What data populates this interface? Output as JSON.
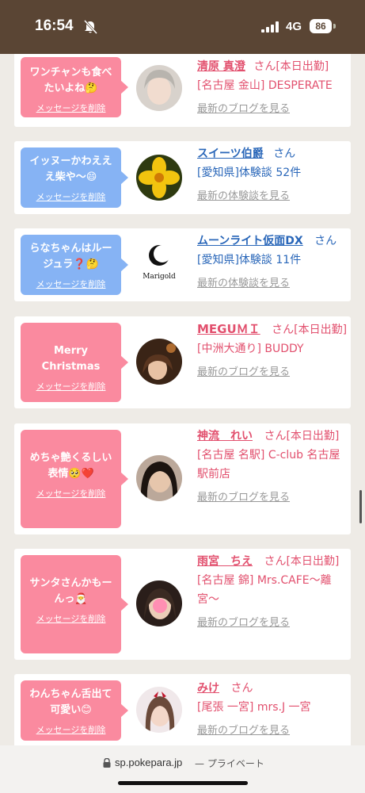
{
  "status_bar": {
    "time": "16:54",
    "network": "4G",
    "battery": "86"
  },
  "colors": {
    "status_bg": "#5a4534",
    "pink_bubble": "#fa8a9f",
    "blue_bubble": "#86b3f4",
    "name_pink": "#e2506e",
    "name_blue": "#2a67b9",
    "page_bg": "#eeebe6"
  },
  "delete_label": "メッセージを削除",
  "items": [
    {
      "message": "ワンチャンも食べたいよね🤔",
      "name": "清原 真澄",
      "suffix": "さん[本日出勤]",
      "detail": "[名古屋 金山] DESPERATE",
      "link": "最新のブログを見る"
    },
    {
      "message": "イッヌーかわえええ柴や〜😄",
      "name": "スイーツ伯爵",
      "suffix": "さん",
      "detail": "[愛知県]体験談 52件",
      "link": "最新の体験談を見る"
    },
    {
      "message": "らなちゃんはルージュラ❓🤔",
      "name": "ムーンライト仮面DX",
      "suffix": "さん",
      "detail": "[愛知県]体験談 11件",
      "link": "最新の体験談を見る",
      "avatar_logo": "Marigold"
    },
    {
      "message": "Merry Christmas",
      "name": "MEGUＭＩ",
      "suffix": "さん[本日出勤]",
      "detail": "[中洲大通り] BUDDY",
      "link": "最新のブログを見る"
    },
    {
      "message": "めちゃ艶くるしい表情🥺❤️",
      "name": "神流　れい",
      "suffix": "さん[本日出勤]",
      "detail": "[名古屋 名駅] C-club 名古屋駅前店",
      "link": "最新のブログを見る"
    },
    {
      "message": "サンタさんかもーんっ🎅",
      "name": "雨宮　ちえ",
      "suffix": "さん[本日出勤]",
      "detail": "[名古屋 錦] Mrs.CAFE〜離宮〜",
      "link": "最新のブログを見る"
    },
    {
      "message": "わんちゃん舌出て可愛い😊",
      "name": "みけ",
      "suffix": "さん",
      "detail": "[尾張 一宮] mrs.J 一宮",
      "link": "最新のブログを見る"
    }
  ],
  "url_bar": {
    "domain": "sp.pokepara.jp",
    "mode": "— プライベート"
  }
}
